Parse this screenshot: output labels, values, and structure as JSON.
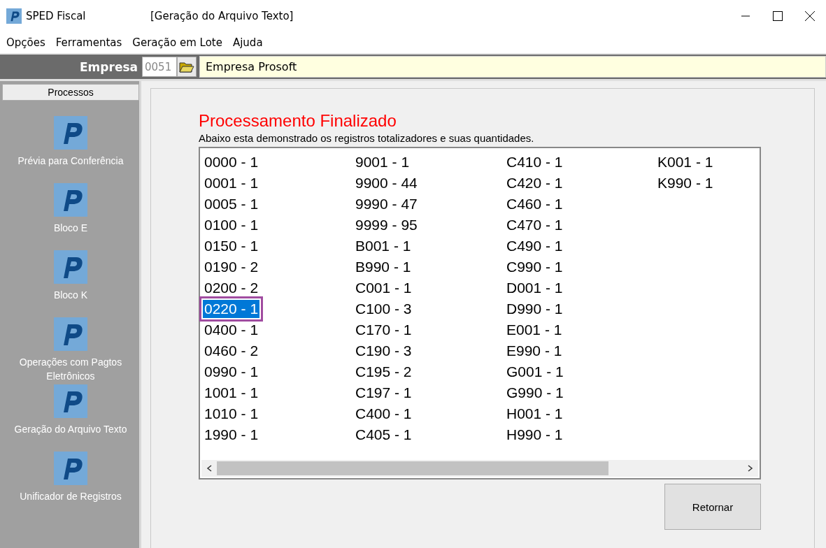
{
  "window": {
    "app_title": "SPED Fiscal",
    "title": "[Geração do Arquivo Texto]"
  },
  "menu": [
    "Opções",
    "Ferramentas",
    "Geração em Lote",
    "Ajuda"
  ],
  "company": {
    "label": "Empresa",
    "code": "0051",
    "name": "Empresa Prosoft"
  },
  "sidebar": {
    "header": "Processos",
    "items": [
      {
        "label": "Prévia para Conferência"
      },
      {
        "label": "Bloco E"
      },
      {
        "label": "Bloco K"
      },
      {
        "label": "Operações com Pagtos Eletrônicos"
      },
      {
        "label": "Geração do Arquivo Texto"
      },
      {
        "label": "Unificador de Registros"
      }
    ]
  },
  "content": {
    "heading": "Processamento Finalizado",
    "description": "Abaixo esta demonstrado os registros totalizadores e suas quantidades.",
    "records": [
      {
        "text": "0000 - 1",
        "selected": false
      },
      {
        "text": "0001 - 1",
        "selected": false
      },
      {
        "text": "0005 - 1",
        "selected": false
      },
      {
        "text": "0100 - 1",
        "selected": false
      },
      {
        "text": "0150 - 1",
        "selected": false
      },
      {
        "text": "0190 - 2",
        "selected": false
      },
      {
        "text": "0200 - 2",
        "selected": false
      },
      {
        "text": "0220 - 1",
        "selected": true
      },
      {
        "text": "0400 - 1",
        "selected": false
      },
      {
        "text": "0460 - 2",
        "selected": false
      },
      {
        "text": "0990 - 1",
        "selected": false
      },
      {
        "text": "1001 - 1",
        "selected": false
      },
      {
        "text": "1010 - 1",
        "selected": false
      },
      {
        "text": "1990 - 1",
        "selected": false
      },
      {
        "text": "9001 - 1",
        "selected": false
      },
      {
        "text": "9900 - 44",
        "selected": false
      },
      {
        "text": "9990 - 47",
        "selected": false
      },
      {
        "text": "9999 - 95",
        "selected": false
      },
      {
        "text": "B001 - 1",
        "selected": false
      },
      {
        "text": "B990 - 1",
        "selected": false
      },
      {
        "text": "C001 - 1",
        "selected": false
      },
      {
        "text": "C100 - 3",
        "selected": false
      },
      {
        "text": "C170 - 1",
        "selected": false
      },
      {
        "text": "C190 - 3",
        "selected": false
      },
      {
        "text": "C195 - 2",
        "selected": false
      },
      {
        "text": "C197 - 1",
        "selected": false
      },
      {
        "text": "C400 - 1",
        "selected": false
      },
      {
        "text": "C405 - 1",
        "selected": false
      },
      {
        "text": "C410 - 1",
        "selected": false
      },
      {
        "text": "C420 - 1",
        "selected": false
      },
      {
        "text": "C460 - 1",
        "selected": false
      },
      {
        "text": "C470 - 1",
        "selected": false
      },
      {
        "text": "C490 - 1",
        "selected": false
      },
      {
        "text": "C990 - 1",
        "selected": false
      },
      {
        "text": "D001 - 1",
        "selected": false
      },
      {
        "text": "D990 - 1",
        "selected": false
      },
      {
        "text": "E001 - 1",
        "selected": false
      },
      {
        "text": "E990 - 1",
        "selected": false
      },
      {
        "text": "G001 - 1",
        "selected": false
      },
      {
        "text": "G990 - 1",
        "selected": false
      },
      {
        "text": "H001 - 1",
        "selected": false
      },
      {
        "text": "H990 - 1",
        "selected": false
      },
      {
        "text": "K001 - 1",
        "selected": false
      },
      {
        "text": "K990 - 1",
        "selected": false
      }
    ],
    "button": "Retornar"
  }
}
